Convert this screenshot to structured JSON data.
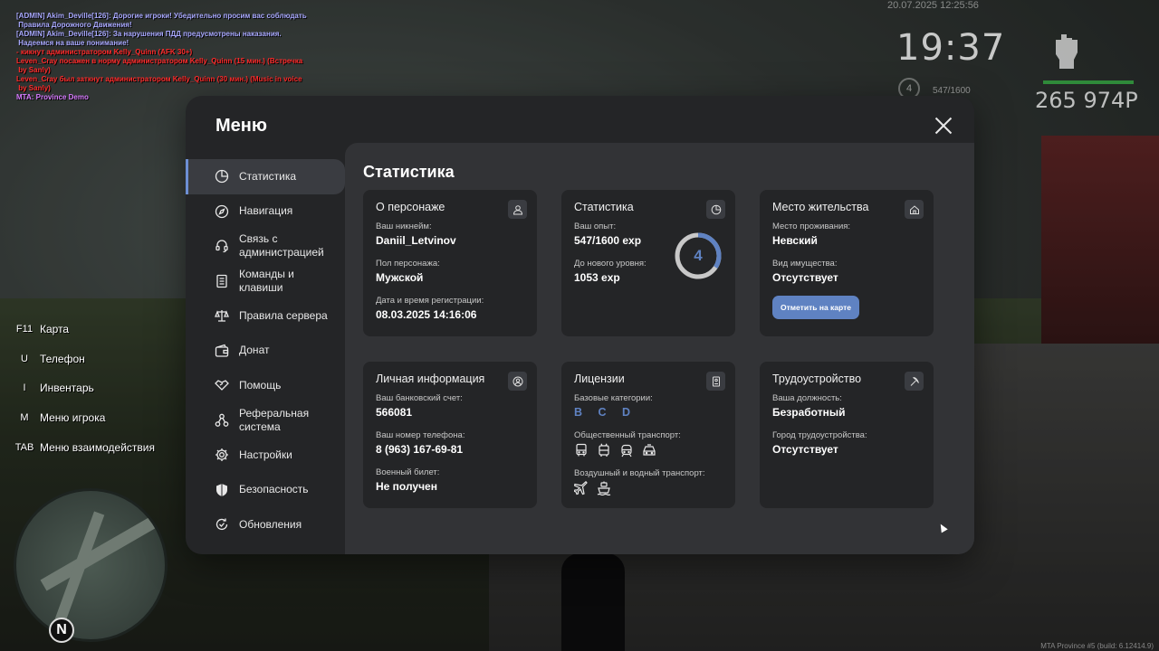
{
  "chat": [
    {
      "text": "[ADMIN] Akim_Deville[126]: Дорогие игроки! Убедительно просим вас соблюдать\n Правила Дорожного Движения!",
      "color": "#a9a9ff"
    },
    {
      "text": "[ADMIN] Akim_Deville[126]: За нарушения ПДД предусмотрены наказания.\n Надеемся на ваше понимание!",
      "color": "#a9a9ff"
    },
    {
      "text": "- кикнут администратором Kelly_Quinn (AFK 30+)",
      "color": "#ff2b2b"
    },
    {
      "text": "Leven_Cray посажен в норму администратором Kelly_Quinn (15 мин.) (Встречка\n by Sanly)",
      "color": "#ff2b2b"
    },
    {
      "text": "Leven_Cray был заткнут администратором Kelly_Quinn (30 мин.) (Music in voice\n by Sanly)",
      "color": "#ff2b2b"
    },
    {
      "text": "MTA: Province Demo",
      "color": "#d77bff"
    }
  ],
  "hud": {
    "date": "20.07.2025 12:25:56",
    "time": "19:37",
    "level": "4",
    "exp": "547/1600",
    "money": "265 974Р"
  },
  "keybinds": [
    {
      "key": "F11",
      "label": "Карта"
    },
    {
      "key": "U",
      "label": "Телефон"
    },
    {
      "key": "I",
      "label": "Инвентарь"
    },
    {
      "key": "M",
      "label": "Меню игрока"
    },
    {
      "key": "TAB",
      "label": "Меню взаимодействия"
    }
  ],
  "build": "MTA Province #5 (build: 6.12414.9)",
  "menu": {
    "title": "Меню",
    "sidebar": [
      {
        "label": "Статистика",
        "icon": "pie-chart-icon"
      },
      {
        "label": "Навигация",
        "icon": "compass-icon"
      },
      {
        "label": "Связь с\nадминистрацией",
        "icon": "headset-icon"
      },
      {
        "label": "Команды и\nклавиши",
        "icon": "document-icon"
      },
      {
        "label": "Правила сервера",
        "icon": "scales-icon"
      },
      {
        "label": "Донат",
        "icon": "wallet-icon"
      },
      {
        "label": "Помощь",
        "icon": "handshake-icon"
      },
      {
        "label": "Реферальная\nсистема",
        "icon": "network-icon"
      },
      {
        "label": "Настройки",
        "icon": "gear-icon"
      },
      {
        "label": "Безопасность",
        "icon": "shield-icon"
      },
      {
        "label": "Обновления",
        "icon": "refresh-icon"
      }
    ],
    "content_title": "Статистика",
    "cards": {
      "character": {
        "title": "О персонаже",
        "nickname_label": "Ваш никнейм:",
        "nickname": "Daniil_Letvinov",
        "gender_label": "Пол персонажа:",
        "gender": "Мужской",
        "reg_label": "Дата и время регистрации:",
        "reg": "08.03.2025 14:16:06"
      },
      "stats": {
        "title": "Статистика",
        "exp_label": "Ваш опыт:",
        "exp": "547/1600 exp",
        "next_label": "До нового уровня:",
        "next": "1053 exp",
        "level": "4",
        "progress": 0.342
      },
      "residence": {
        "title": "Место жительства",
        "place_label": "Место проживания:",
        "place": "Невский",
        "property_label": "Вид имущества:",
        "property": "Отсутствует",
        "button": "Отметить на карте"
      },
      "personal": {
        "title": "Личная информация",
        "bank_label": "Ваш банковский счет:",
        "bank": "566081",
        "phone_label": "Ваш номер телефона:",
        "phone": "8 (963) 167-69-81",
        "military_label": "Военный билет:",
        "military": "Не получен"
      },
      "licenses": {
        "title": "Лицензии",
        "base_label": "Базовые категории:",
        "base": "B C D",
        "public_label": "Общественный транспорт:",
        "air_label": "Воздушный и водный транспорт:"
      },
      "job": {
        "title": "Трудоустройство",
        "position_label": "Ваша должность:",
        "position": "Безработный",
        "city_label": "Город трудоустройства:",
        "city": "Отсутствует"
      }
    }
  },
  "colors": {
    "accent": "#5f82c2",
    "panel": "#242527",
    "content": "#323336"
  }
}
